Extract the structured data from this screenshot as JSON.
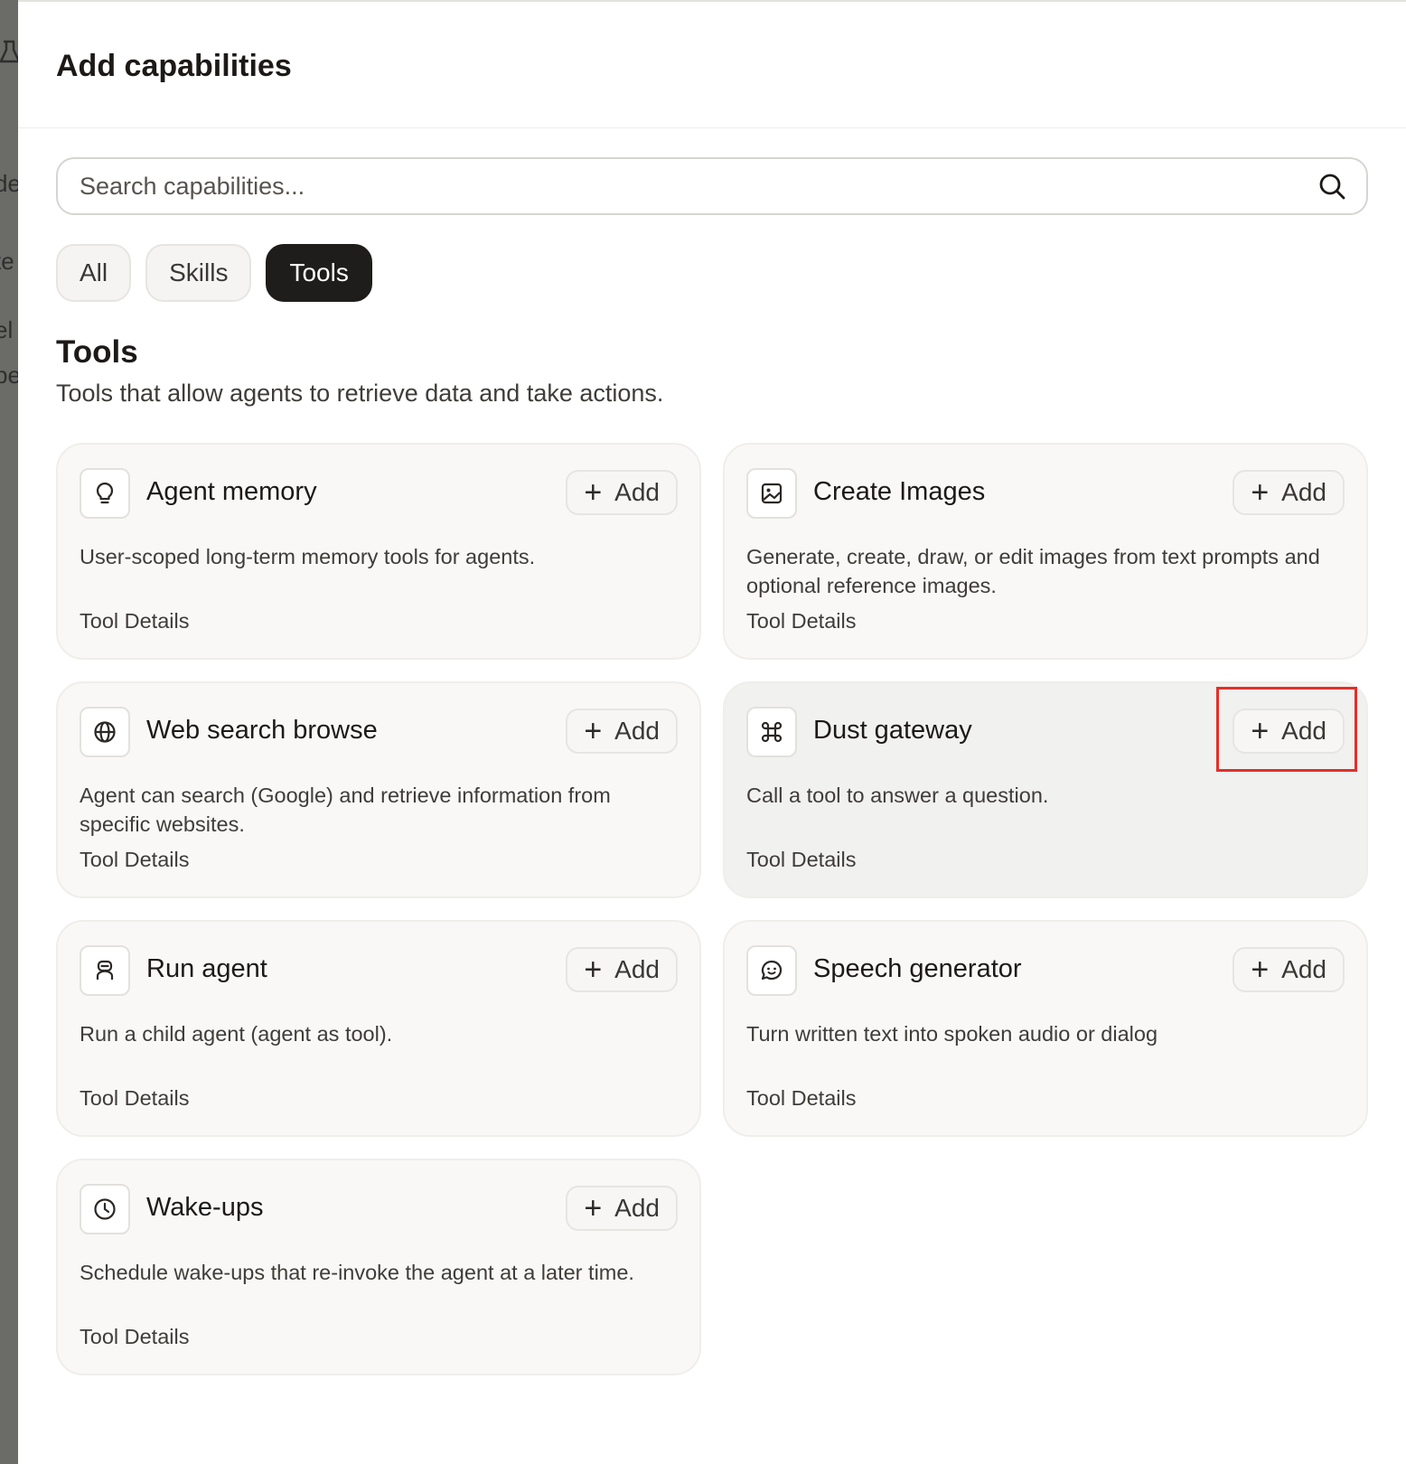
{
  "backdrop": {
    "fragments": [
      "de",
      "te",
      "el",
      "pe"
    ]
  },
  "dialog": {
    "title": "Add capabilities",
    "search": {
      "placeholder": "Search capabilities...",
      "value": ""
    },
    "tabs": [
      {
        "label": "All",
        "active": false
      },
      {
        "label": "Skills",
        "active": false
      },
      {
        "label": "Tools",
        "active": true
      }
    ],
    "section": {
      "title": "Tools",
      "description": "Tools that allow agents to retrieve data and take actions."
    },
    "tools": [
      {
        "name": "Agent memory",
        "icon": "lightbulb-icon",
        "description": "User-scoped long-term memory tools for agents.",
        "add_label": "Add",
        "details_label": "Tool Details"
      },
      {
        "name": "Create Images",
        "icon": "image-icon",
        "description": "Generate, create, draw, or edit images from text prompts and optional reference images.",
        "add_label": "Add",
        "details_label": "Tool Details"
      },
      {
        "name": "Web search browse",
        "icon": "globe-icon",
        "description": "Agent can search (Google) and retrieve information from specific websites.",
        "add_label": "Add",
        "details_label": "Tool Details"
      },
      {
        "name": "Dust gateway",
        "icon": "command-icon",
        "description": "Call a tool to answer a question.",
        "add_label": "Add",
        "details_label": "Tool Details"
      },
      {
        "name": "Run agent",
        "icon": "robot-icon",
        "description": "Run a child agent (agent as tool).",
        "add_label": "Add",
        "details_label": "Tool Details"
      },
      {
        "name": "Speech generator",
        "icon": "speech-bubble-icon",
        "description": "Turn written text into spoken audio or dialog",
        "add_label": "Add",
        "details_label": "Tool Details"
      },
      {
        "name": "Wake-ups",
        "icon": "clock-icon",
        "description": "Schedule wake-ups that re-invoke the agent at a later time.",
        "add_label": "Add",
        "details_label": "Tool Details"
      }
    ]
  },
  "colors": {
    "highlight": "#e0302a",
    "active_tab": "#1f1d1b",
    "card_bg": "#f9f8f6"
  }
}
